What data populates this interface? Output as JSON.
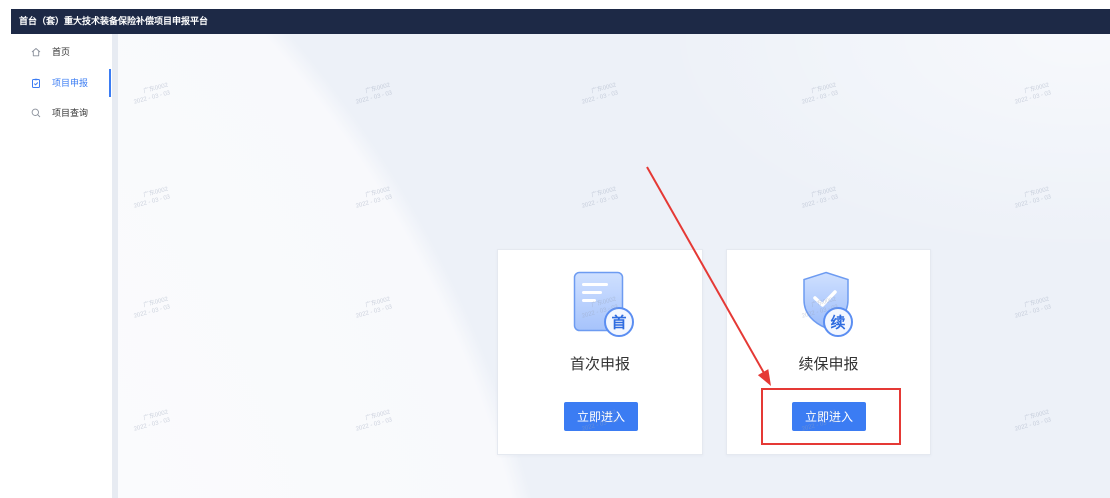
{
  "app": {
    "title": "首台（套）重大技术装备保险补偿项目申报平台"
  },
  "colors": {
    "top_bar": "#1d2946",
    "accent": "#3b7cf3",
    "annotation": "#e53935"
  },
  "sidebar": {
    "items": [
      {
        "label": "首页",
        "icon": "home-icon",
        "active": false
      },
      {
        "label": "项目申报",
        "icon": "clipboard-icon",
        "active": true
      },
      {
        "label": "项目查询",
        "icon": "search-icon",
        "active": false
      }
    ]
  },
  "main": {
    "cards": [
      {
        "title": "首次申报",
        "badge": "首",
        "icon": "document-icon",
        "button_label": "立即进入"
      },
      {
        "title": "续保申报",
        "badge": "续",
        "icon": "shield-check-icon",
        "button_label": "立即进入"
      }
    ]
  },
  "watermark": {
    "line1": "广东0002",
    "line2": "2022 - 03 - 03"
  }
}
